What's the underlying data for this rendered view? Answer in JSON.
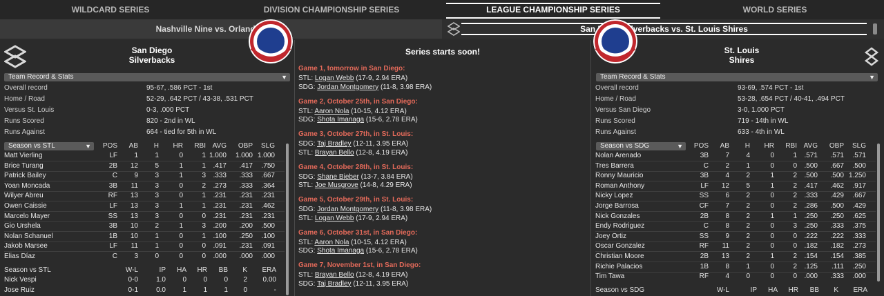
{
  "tabs": [
    "WILDCARD SERIES",
    "DIVISION CHAMPIONSHIP SERIES",
    "LEAGUE CHAMPIONSHIP SERIES",
    "WORLD SERIES"
  ],
  "active_tab": "LEAGUE CHAMPIONSHIP SERIES",
  "left_matchup": "Nashville Nine vs. Orlando Orcas",
  "right_matchup": "San Diego Silverbacks vs. St. Louis Shires",
  "center": {
    "title": "Series starts soon!",
    "games": [
      {
        "title": "Game 1, tomorrow in San Diego:",
        "lines": [
          {
            "team": "STL:",
            "player": "Logan Webb",
            "stats": "(17-9, 2.94 ERA)"
          },
          {
            "team": "SDG:",
            "player": "Jordan Montgomery",
            "stats": "(11-8, 3.98 ERA)"
          }
        ]
      },
      {
        "title": "Game 2, October 25th,  in San Diego:",
        "lines": [
          {
            "team": "STL:",
            "player": "Aaron Nola",
            "stats": "(10-15, 4.12 ERA)"
          },
          {
            "team": "SDG:",
            "player": "Shota Imanaga",
            "stats": "(15-6, 2.78 ERA)"
          }
        ]
      },
      {
        "title": "Game 3, October 27th,  in St. Louis:",
        "lines": [
          {
            "team": "SDG:",
            "player": "Taj Bradley",
            "stats": "(12-11, 3.95 ERA)"
          },
          {
            "team": "STL:",
            "player": "Brayan Bello",
            "stats": "(12-8, 4.19 ERA)"
          }
        ]
      },
      {
        "title": "Game 4, October 28th,  in St. Louis:",
        "lines": [
          {
            "team": "SDG:",
            "player": "Shane Bieber",
            "stats": "(13-7, 3.84 ERA)"
          },
          {
            "team": "STL:",
            "player": "Joe Musgrove",
            "stats": "(14-8, 4.29 ERA)"
          }
        ]
      },
      {
        "title": "Game 5, October 29th,  in St. Louis:",
        "lines": [
          {
            "team": "SDG:",
            "player": "Jordan Montgomery",
            "stats": "(11-8, 3.98 ERA)"
          },
          {
            "team": "STL:",
            "player": "Logan Webb",
            "stats": "(17-9, 2.94 ERA)"
          }
        ]
      },
      {
        "title": "Game 6, October 31st,  in San Diego:",
        "lines": [
          {
            "team": "STL:",
            "player": "Aaron Nola",
            "stats": "(10-15, 4.12 ERA)"
          },
          {
            "team": "SDG:",
            "player": "Shota Imanaga",
            "stats": "(15-6, 2.78 ERA)"
          }
        ]
      },
      {
        "title": "Game 7, November 1st,  in San Diego:",
        "lines": [
          {
            "team": "STL:",
            "player": "Brayan Bello",
            "stats": "(12-8, 4.19 ERA)"
          },
          {
            "team": "SDG:",
            "player": "Taj Bradley",
            "stats": "(12-11, 3.95 ERA)"
          }
        ]
      }
    ]
  },
  "left": {
    "team_name_1": "San Diego",
    "team_name_2": "Silverbacks",
    "record_dropdown": "Team Record & Stats",
    "records": [
      {
        "k": "Overall record",
        "v": "95-67, .586 PCT - 1st"
      },
      {
        "k": "Home / Road",
        "v": "52-29, .642 PCT / 43-38, .531 PCT"
      },
      {
        "k": "Versus St. Louis",
        "v": "0-3, .000 PCT"
      },
      {
        "k": "Runs Scored",
        "v": "820 - 2nd in WL"
      },
      {
        "k": "Runs Against",
        "v": "664 - tied for 5th in WL"
      }
    ],
    "bat_dropdown": "Season vs STL",
    "bat_headers": [
      "POS",
      "AB",
      "H",
      "HR",
      "RBI",
      "AVG",
      "OBP",
      "SLG"
    ],
    "batters": [
      [
        "Matt Vierling",
        "LF",
        "1",
        "1",
        "0",
        "1",
        "1.000",
        "1.000",
        "1.000"
      ],
      [
        "Brice Turang",
        "2B",
        "12",
        "5",
        "1",
        "1",
        ".417",
        ".417",
        ".750"
      ],
      [
        "Patrick Bailey",
        "C",
        "9",
        "3",
        "1",
        "3",
        ".333",
        ".333",
        ".667"
      ],
      [
        "Yoan Moncada",
        "3B",
        "11",
        "3",
        "0",
        "2",
        ".273",
        ".333",
        ".364"
      ],
      [
        "Wilyer Abreu",
        "RF",
        "13",
        "3",
        "0",
        "1",
        ".231",
        ".231",
        ".231"
      ],
      [
        "Owen Caissie",
        "LF",
        "13",
        "3",
        "1",
        "1",
        ".231",
        ".231",
        ".462"
      ],
      [
        "Marcelo Mayer",
        "SS",
        "13",
        "3",
        "0",
        "0",
        ".231",
        ".231",
        ".231"
      ],
      [
        "Gio Urshela",
        "3B",
        "10",
        "2",
        "1",
        "3",
        ".200",
        ".200",
        ".500"
      ],
      [
        "Nolan Schanuel",
        "1B",
        "10",
        "1",
        "0",
        "1",
        ".100",
        ".250",
        ".100"
      ],
      [
        "Jakob Marsee",
        "LF",
        "11",
        "1",
        "0",
        "0",
        ".091",
        ".231",
        ".091"
      ],
      [
        "Elias Díaz",
        "C",
        "3",
        "0",
        "0",
        "0",
        ".000",
        ".000",
        ".000"
      ]
    ],
    "pit_label": "Season vs STL",
    "pit_headers": [
      "W-L",
      "IP",
      "HA",
      "HR",
      "BB",
      "K",
      "ERA"
    ],
    "pitchers": [
      [
        "Nick Vespi",
        "0-0",
        "1.0",
        "0",
        "0",
        "0",
        "2",
        "0.00"
      ],
      [
        "Jose Ruiz",
        "0-1",
        "0.0",
        "1",
        "1",
        "1",
        "0",
        "-"
      ]
    ]
  },
  "right": {
    "team_name_1": "St. Louis",
    "team_name_2": "Shires",
    "record_dropdown": "Team Record & Stats",
    "records": [
      {
        "k": "Overall record",
        "v": "93-69, .574 PCT - 1st"
      },
      {
        "k": "Home / Road",
        "v": "53-28, .654 PCT / 40-41, .494 PCT"
      },
      {
        "k": "Versus San Diego",
        "v": "3-0, 1.000 PCT"
      },
      {
        "k": "Runs Scored",
        "v": "719 - 14th in WL"
      },
      {
        "k": "Runs Against",
        "v": "633 - 4th in WL"
      }
    ],
    "bat_dropdown": "Season vs SDG",
    "bat_headers": [
      "POS",
      "AB",
      "H",
      "HR",
      "RBI",
      "AVG",
      "OBP",
      "SLG"
    ],
    "batters": [
      [
        "Nolan Arenado",
        "3B",
        "7",
        "4",
        "0",
        "1",
        ".571",
        ".571",
        ".571"
      ],
      [
        "Tres Barrera",
        "C",
        "2",
        "1",
        "0",
        "0",
        ".500",
        ".667",
        ".500"
      ],
      [
        "Ronny Mauricio",
        "3B",
        "4",
        "2",
        "1",
        "2",
        ".500",
        ".500",
        "1.250"
      ],
      [
        "Roman Anthony",
        "LF",
        "12",
        "5",
        "1",
        "2",
        ".417",
        ".462",
        ".917"
      ],
      [
        "Nicky Lopez",
        "SS",
        "6",
        "2",
        "0",
        "2",
        ".333",
        ".429",
        ".667"
      ],
      [
        "Jorge Barrosa",
        "CF",
        "7",
        "2",
        "0",
        "2",
        ".286",
        ".500",
        ".429"
      ],
      [
        "Nick Gonzales",
        "2B",
        "8",
        "2",
        "1",
        "1",
        ".250",
        ".250",
        ".625"
      ],
      [
        "Endy Rodriguez",
        "C",
        "8",
        "2",
        "0",
        "3",
        ".250",
        ".333",
        ".375"
      ],
      [
        "Joey Ortiz",
        "SS",
        "9",
        "2",
        "0",
        "0",
        ".222",
        ".222",
        ".333"
      ],
      [
        "Oscar Gonzalez",
        "RF",
        "11",
        "2",
        "0",
        "0",
        ".182",
        ".182",
        ".273"
      ],
      [
        "Christian Moore",
        "2B",
        "13",
        "2",
        "1",
        "2",
        ".154",
        ".154",
        ".385"
      ],
      [
        "Richie Palacios",
        "1B",
        "8",
        "1",
        "0",
        "2",
        ".125",
        ".111",
        ".250"
      ],
      [
        "Tim Tawa",
        "RF",
        "4",
        "0",
        "0",
        "0",
        ".000",
        ".333",
        ".000"
      ]
    ],
    "pit_label": "Season vs SDG",
    "pit_headers": [
      "W-L",
      "IP",
      "HA",
      "HR",
      "BB",
      "K",
      "ERA"
    ],
    "pitchers": []
  },
  "colors": {
    "game_title": "#e46a5a",
    "active_tab_underline": "#ffffff"
  },
  "icons": {
    "logo": "silverbacks-s-logo-icon",
    "bunting": "patriotic-bunting-icon"
  }
}
